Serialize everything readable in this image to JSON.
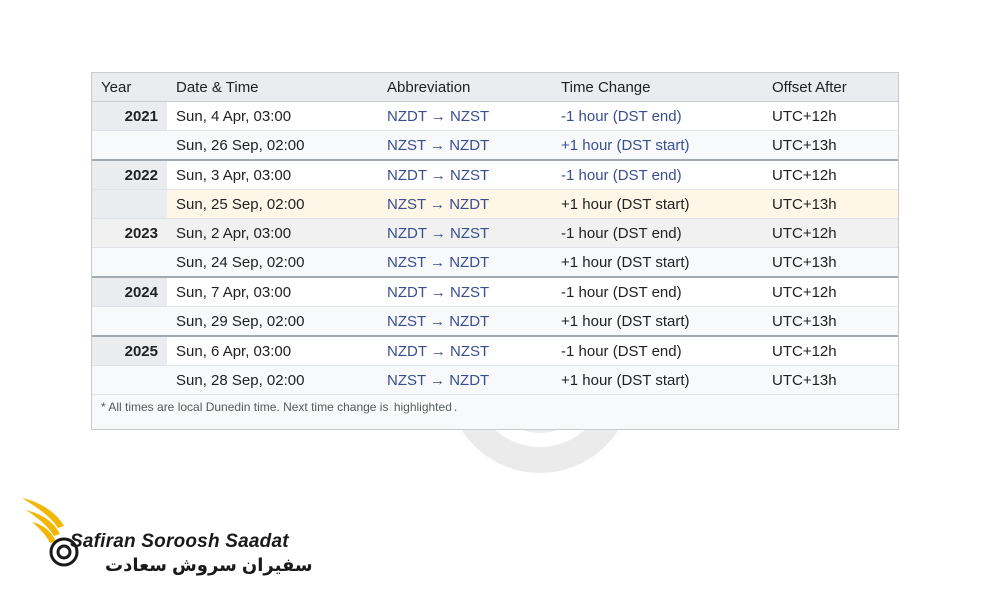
{
  "table": {
    "headers": [
      "Year",
      "Date & Time",
      "Abbreviation",
      "Time Change",
      "Offset After"
    ],
    "rows": [
      {
        "year": "2021",
        "date": "Sun, 4 Apr, 03:00",
        "abbr": "NZDT → NZST",
        "change": "-1 hour (DST end)",
        "offset": "UTC+12h"
      },
      {
        "year": "",
        "date": "Sun, 26 Sep, 02:00",
        "abbr": "NZST → NZDT",
        "change": "+1 hour (DST start)",
        "offset": "UTC+13h"
      },
      {
        "year": "2022",
        "date": "Sun, 3 Apr, 03:00",
        "abbr": "NZDT → NZST",
        "change": "-1 hour (DST end)",
        "offset": "UTC+12h"
      },
      {
        "year": "",
        "date": "Sun, 25 Sep, 02:00",
        "abbr": "NZST → NZDT",
        "change": "+1 hour (DST start)",
        "offset": "UTC+13h"
      },
      {
        "year": "2023",
        "date": "Sun, 2 Apr, 03:00",
        "abbr": "NZDT → NZST",
        "change": "-1 hour (DST end)",
        "offset": "UTC+12h"
      },
      {
        "year": "",
        "date": "Sun, 24 Sep, 02:00",
        "abbr": "NZST → NZDT",
        "change": "+1 hour (DST start)",
        "offset": "UTC+13h"
      },
      {
        "year": "2024",
        "date": "Sun, 7 Apr, 03:00",
        "abbr": "NZDT → NZST",
        "change": "-1 hour (DST end)",
        "offset": "UTC+12h"
      },
      {
        "year": "",
        "date": "Sun, 29 Sep, 02:00",
        "abbr": "NZST → NZDT",
        "change": "+1 hour (DST start)",
        "offset": "UTC+13h"
      },
      {
        "year": "2025",
        "date": "Sun, 6 Apr, 03:00",
        "abbr": "NZDT → NZST",
        "change": "-1 hour (DST end)",
        "offset": "UTC+12h"
      },
      {
        "year": "",
        "date": "Sun, 28 Sep, 02:00",
        "abbr": "NZST → NZDT",
        "change": "+1 hour (DST start)",
        "offset": "UTC+13h"
      }
    ]
  },
  "footnote": {
    "text": "* All times are local Dunedin time. Next time change is",
    "highlight": "highlighted",
    "end": "."
  },
  "brand": {
    "name_en": "Safiran Soroosh Saadat",
    "name_fa": "سفیران سروش سعادت",
    "gold": "#f2b705"
  },
  "colors": {
    "link": "#3a4d8f",
    "highlight": "#fef6e7",
    "header_bg": "#eaecf0"
  }
}
